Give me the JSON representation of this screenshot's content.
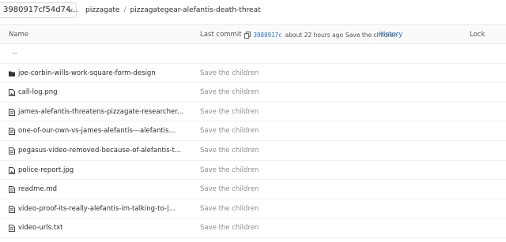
{
  "branch": {
    "label": "3980917cf54d74..."
  },
  "breadcrumb": {
    "project": "pizzagate",
    "separator": "/",
    "folder": "pizzagategear-alefantis-death-threat"
  },
  "table_header": {
    "name": "Name",
    "last_commit": "Last commit",
    "commit_sha": "3980917c",
    "commit_time": "about 22 hours ago",
    "commit_message": "Save the children",
    "history": "History",
    "lock": "Lock"
  },
  "parent_link": "..",
  "files": [
    {
      "name": "joe-corbin-wills-work-square-form-design",
      "type": "folder",
      "message": "Save the children"
    },
    {
      "name": "call-log.png",
      "type": "image",
      "message": "Save the children"
    },
    {
      "name": "james-alefantis-threatens-pizzagate-researcher...",
      "type": "file",
      "message": "Save the children"
    },
    {
      "name": "one-of-our-own-vs-james-alefantis---alefantis...",
      "type": "file",
      "message": "Save the children"
    },
    {
      "name": "pegasus-video-removed-because-of-alefantis-t...",
      "type": "file",
      "message": "Save the children"
    },
    {
      "name": "police-report.jpg",
      "type": "image",
      "message": "Save the children"
    },
    {
      "name": "readme.md",
      "type": "file",
      "message": "Save the children"
    },
    {
      "name": "video-proof-its-really-alefantis-im-talking-to-|...",
      "type": "file",
      "message": "Save the children"
    },
    {
      "name": "video-urls.txt",
      "type": "file",
      "message": "Save the children"
    }
  ],
  "icons": {
    "folder": "folder-icon",
    "image": "image-file-icon",
    "file": "file-icon"
  },
  "colors": {
    "link": "#1f78d1",
    "muted": "#8c8c8c",
    "text": "#2e2e2e"
  }
}
